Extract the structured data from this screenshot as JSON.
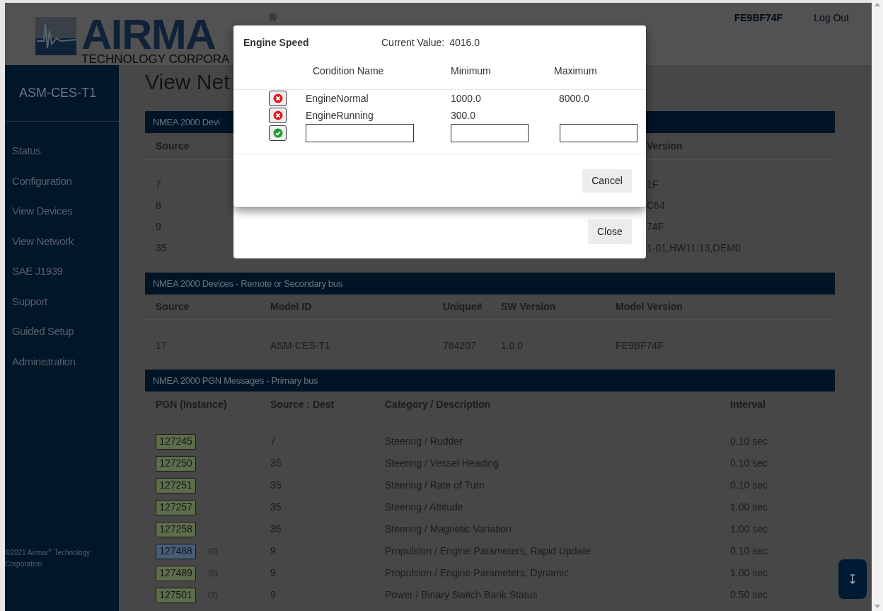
{
  "header": {
    "logo_word": "AIRMA",
    "logo_mark": "®",
    "logo_tagline": "TECHNOLOGY CORPORA",
    "links": [
      {
        "label": "FE9BF74F",
        "kind": "device"
      },
      {
        "label": "Log Out",
        "kind": "action"
      }
    ]
  },
  "sidebar": {
    "device": "ASM-CES-T1",
    "items": [
      "Status",
      "Configuration",
      "View Devices",
      "View Network",
      "SAE J1939",
      "Support",
      "Guided Setup",
      "Administration"
    ],
    "footer": "©2021 Airmar$^{®}$ Technology Corporation"
  },
  "page_title": "View Net",
  "primary_devices": {
    "title": "NMEA 2000 Devi",
    "columns": [
      "Source",
      "Version"
    ],
    "rows": [
      [
        "7",
        "1F"
      ],
      [
        "8",
        "C64"
      ],
      [
        "9",
        "74F"
      ],
      [
        "35",
        "1-01,HW11:13,OEM0"
      ]
    ]
  },
  "secondary_devices": {
    "title": "NMEA 2000 Devices - Remote or Secondary bus",
    "columns": [
      "Source",
      "Model ID",
      "Unique#",
      "SW Version",
      "Model Version"
    ],
    "rows": [
      [
        "17",
        "ASM-CES-T1",
        "784207",
        "1.0.0",
        "FE9BF74F"
      ]
    ]
  },
  "pgn_messages": {
    "title": "NMEA 2000 PGN Messages - Primary bus",
    "columns": [
      "PGN (Instance)",
      "Source : Dest",
      "Category / Description",
      "Interval"
    ],
    "rows": [
      {
        "pgn": "127245",
        "color": "#5e6e4c",
        "source": "7",
        "description": "Steering / Rudder",
        "interval": "0.10 sec"
      },
      {
        "pgn": "127250",
        "color": "#5e6e4c",
        "source": "35",
        "description": "Steering / Vessel Heading",
        "interval": "0.10 sec"
      },
      {
        "pgn": "127251",
        "color": "#5e6e4c",
        "source": "35",
        "description": "Steering / Rate of Turn",
        "interval": "0.10 sec"
      },
      {
        "pgn": "127257",
        "color": "#5e6e4c",
        "source": "35",
        "description": "Steering / Attitude",
        "interval": "1.00 sec"
      },
      {
        "pgn": "127258",
        "color": "#5e6e4c",
        "source": "35",
        "description": "Steering / Magnetic Variation",
        "interval": "1.00 sec"
      },
      {
        "pgn": "127488",
        "instance": "(0)",
        "color": "#4a5d78",
        "source": "9",
        "description": "Propulsion / Engine Parameters, Rapid Update",
        "interval": "0.10 sec"
      },
      {
        "pgn": "127489",
        "instance": "(0)",
        "color": "#5e6e4c",
        "source": "9",
        "description": "Propulsion / Engine Parameters, Dynamic",
        "interval": "1.00 sec"
      },
      {
        "pgn": "127501",
        "instance": "(3)",
        "color": "#5e6e4c",
        "source": "9",
        "description": "Power / Binary Switch Bank Status",
        "interval": "0.50 sec"
      }
    ]
  },
  "back_dialog": {
    "close_button": "Close"
  },
  "dialog": {
    "title": "Engine Speed",
    "current_label": "Current Value:",
    "current_value": "4016.0",
    "columns": [
      "Condition Name",
      "Minimum",
      "Maximum"
    ],
    "conditions": [
      {
        "name": "EngineNormal",
        "minimum": "1000.0",
        "maximum": "8000.0"
      },
      {
        "name": "EngineRunning",
        "minimum": "300.0"
      }
    ],
    "cancel_button": "Cancel"
  }
}
